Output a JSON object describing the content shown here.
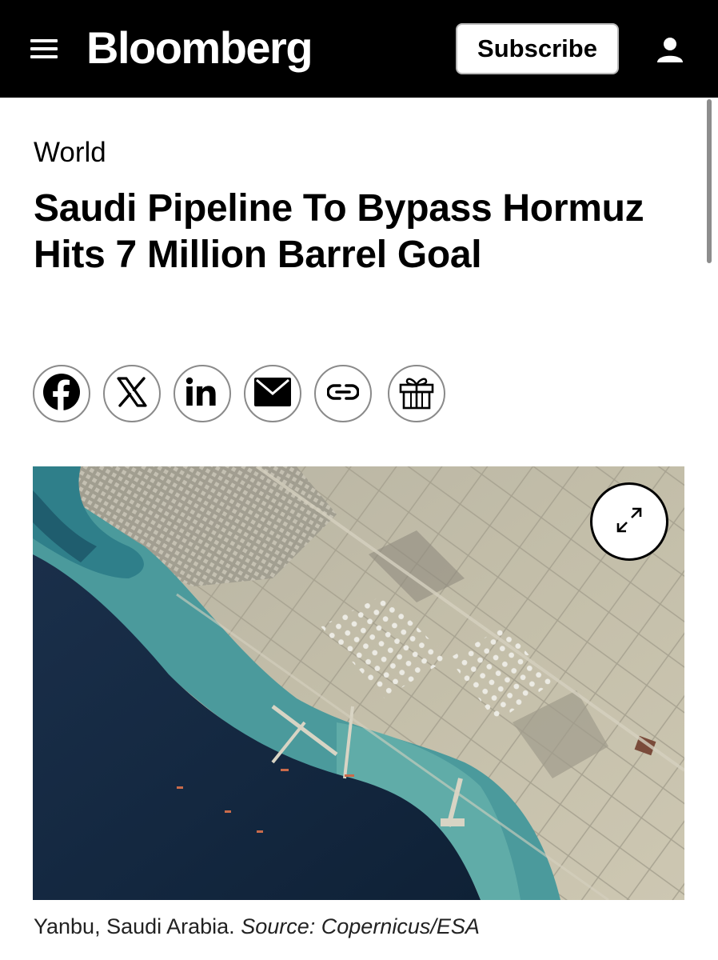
{
  "header": {
    "menu_icon": "hamburger-menu-icon",
    "logo_text": "Bloomberg",
    "subscribe_label": "Subscribe",
    "account_icon": "user-icon",
    "background_color": "#000000"
  },
  "article": {
    "section": "World",
    "headline": "Saudi Pipeline To Bypass Hormuz Hits 7 Million Barrel Goal",
    "share_buttons": [
      {
        "icon": "facebook-icon"
      },
      {
        "icon": "x-icon"
      },
      {
        "icon": "linkedin-icon"
      },
      {
        "icon": "email-icon"
      },
      {
        "icon": "link-icon"
      },
      {
        "icon": "gift-icon"
      }
    ],
    "image": {
      "expand_icon": "expand-icon",
      "caption_text": "Yanbu, Saudi Arabia.",
      "caption_source": "Source: Copernicus/ESA"
    }
  }
}
